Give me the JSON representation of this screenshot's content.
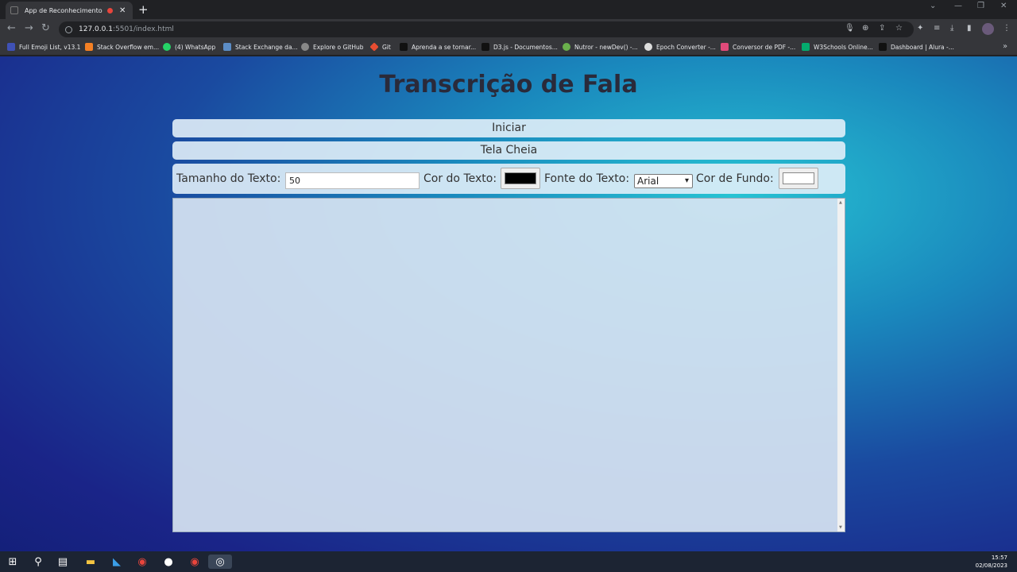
{
  "browser": {
    "tab_title": "App de Reconhecimento de",
    "url_host": "127.0.0.1",
    "url_path": ":5501/index.html",
    "bookmarks": [
      {
        "label": "Full Emoji List, v13.1",
        "color": "#3f51b5"
      },
      {
        "label": "Stack Overflow em...",
        "color": "#f48024"
      },
      {
        "label": "(4) WhatsApp",
        "color": "#25d366"
      },
      {
        "label": "Stack Exchange da...",
        "color": "#5c8dc6"
      },
      {
        "label": "Explore o GitHub",
        "color": "#888888"
      },
      {
        "label": "Git",
        "color": "#e84d31"
      },
      {
        "label": "Aprenda a se tornar...",
        "color": "#111111"
      },
      {
        "label": "D3.js - Documentos...",
        "color": "#111111"
      },
      {
        "label": "Nutror - newDev() -...",
        "color": "#6ab04c"
      },
      {
        "label": "Epoch Converter -...",
        "color": "#dddddd"
      },
      {
        "label": "Conversor de PDF -...",
        "color": "#e04a7a"
      },
      {
        "label": "W3Schools Online...",
        "color": "#04aa6d"
      },
      {
        "label": "Dashboard | Alura -...",
        "color": "#111111"
      }
    ]
  },
  "page": {
    "title": "Transcrição de Fala",
    "start_button": "Iniciar",
    "fullscreen_button": "Tela Cheia",
    "text_size_label": "Tamanho do Texto:",
    "text_size_value": "50",
    "text_color_label": "Cor do Texto:",
    "text_color": "#000000",
    "font_label": "Fonte do Texto:",
    "font_selected": "Arial",
    "bg_color_label": "Cor de Fundo:",
    "bg_color": "#ffffff"
  },
  "taskbar": {
    "time": "15:57",
    "date": "02/08/2023"
  }
}
